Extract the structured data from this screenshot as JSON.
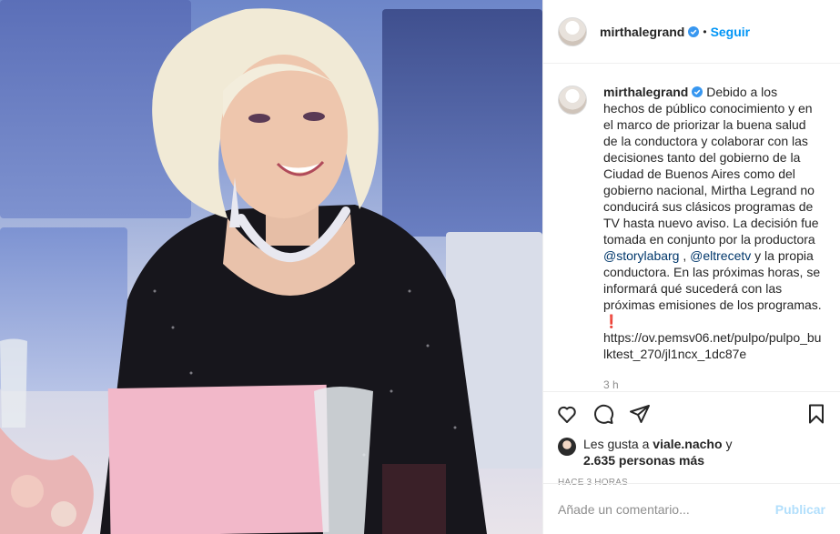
{
  "header": {
    "username": "mirthalegrand",
    "separator": "•",
    "follow_label": "Seguir"
  },
  "caption": {
    "username": "mirthalegrand",
    "text_1": "Debido a los hechos de público conocimiento y en el marco de priorizar la buena salud de la conductora y colaborar con las decisiones tanto del gobierno de la Ciudad de Buenos Aires como del gobierno nacional, Mirtha Legrand no conducirá sus clásicos programas de TV hasta nuevo aviso. La decisión fue tomada en conjunto por la productora",
    "mention_1": "@storylabarg",
    "sep_1": " , ",
    "mention_2": "@eltrecetv",
    "text_2": " y la propia conductora. En las próximas horas, se informará qué sucederá con las próximas emisiones de los programas.",
    "emoji": "❗",
    "link": "https://ov.pemsv06.net/pulpo/pulpo_bulktest_270/jl1ncx_1dc87e",
    "time": "3 h"
  },
  "likes": {
    "prefix": "Les gusta a",
    "user": "viale.nacho",
    "conj": "y",
    "count": "2.635 personas más"
  },
  "ago": "HACE 3 HORAS",
  "comment": {
    "placeholder": "Añade un comentario...",
    "publish_label": "Publicar"
  },
  "colors": {
    "accent": "#0095f6",
    "publish_disabled": "#b2dffc",
    "mention": "#00376b",
    "muted": "#8e8e8e"
  }
}
